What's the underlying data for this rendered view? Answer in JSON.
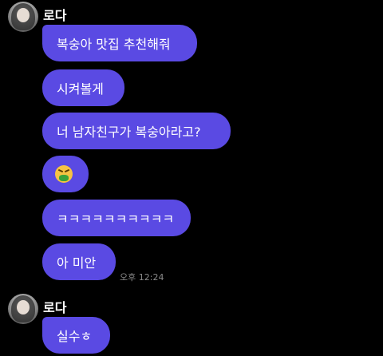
{
  "chat": {
    "groups": [
      {
        "sender": "로다",
        "messages": [
          "복숭아 맛집 추천해줘",
          "시켜볼게",
          "너 남자친구가 복숭아라고?",
          "🤮",
          "ㅋㅋㅋㅋㅋㅋㅋㅋㅋㅋ",
          "아 미안"
        ],
        "time": "오후 12:24"
      },
      {
        "sender": "로다",
        "messages": [
          "실수ㅎ"
        ]
      }
    ]
  },
  "colors": {
    "background": "#000000",
    "bubble": "#5a4ae3",
    "timestamp": "#8a8a8a"
  },
  "icons": {
    "emoji": "nauseated-face-icon",
    "avatar": "profile-photo"
  }
}
